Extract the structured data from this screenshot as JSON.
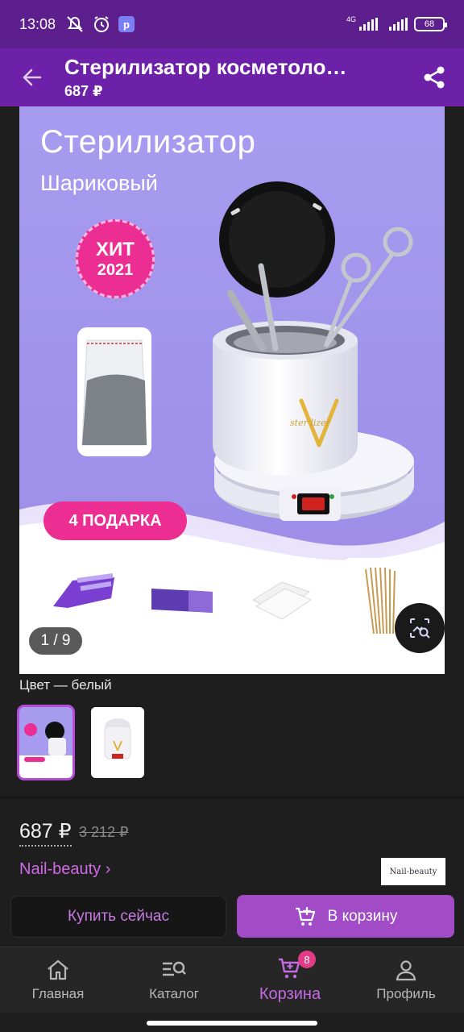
{
  "status_bar": {
    "time": "13:08",
    "network": "4G",
    "battery": "68",
    "icons": [
      "mute-icon",
      "alarm-icon",
      "app-notification-icon"
    ]
  },
  "app_bar": {
    "title": "Стерилизатор косметоло…",
    "subtitle": "687 ₽",
    "back_icon": "arrow-left-icon",
    "share_icon": "share-icon"
  },
  "gallery": {
    "banner_title": "Стерилизатор",
    "banner_subtitle": "Шариковый",
    "badge_line1": "ХИТ",
    "badge_line2": "2021",
    "device_brand": "sterilizer",
    "gifts_label": "4 ПОДАРКА",
    "counter": "1 / 9",
    "lens_icon": "image-search-icon"
  },
  "variants": {
    "label": "Цвет — белый",
    "selected_index": 0
  },
  "pricing": {
    "price": "687 ₽",
    "old_price": "3 212 ₽"
  },
  "seller": {
    "name": "Nail-beauty ›",
    "logo_text": "Nail-beauty"
  },
  "actions": {
    "buy_now": "Купить сейчас",
    "add_to_cart": "В корзину"
  },
  "bottom_nav": {
    "items": [
      {
        "label": "Главная",
        "icon": "home-icon"
      },
      {
        "label": "Каталог",
        "icon": "catalog-search-icon"
      },
      {
        "label": "Корзина",
        "icon": "cart-icon",
        "active": true,
        "badge": "8"
      },
      {
        "label": "Профиль",
        "icon": "profile-icon"
      }
    ]
  },
  "colors": {
    "status_bar": "#5e1f8e",
    "app_bar": "#6c21a8",
    "accent": "#a14cc6",
    "badge_pink": "#ec2e93",
    "background": "#1e1e1e"
  }
}
